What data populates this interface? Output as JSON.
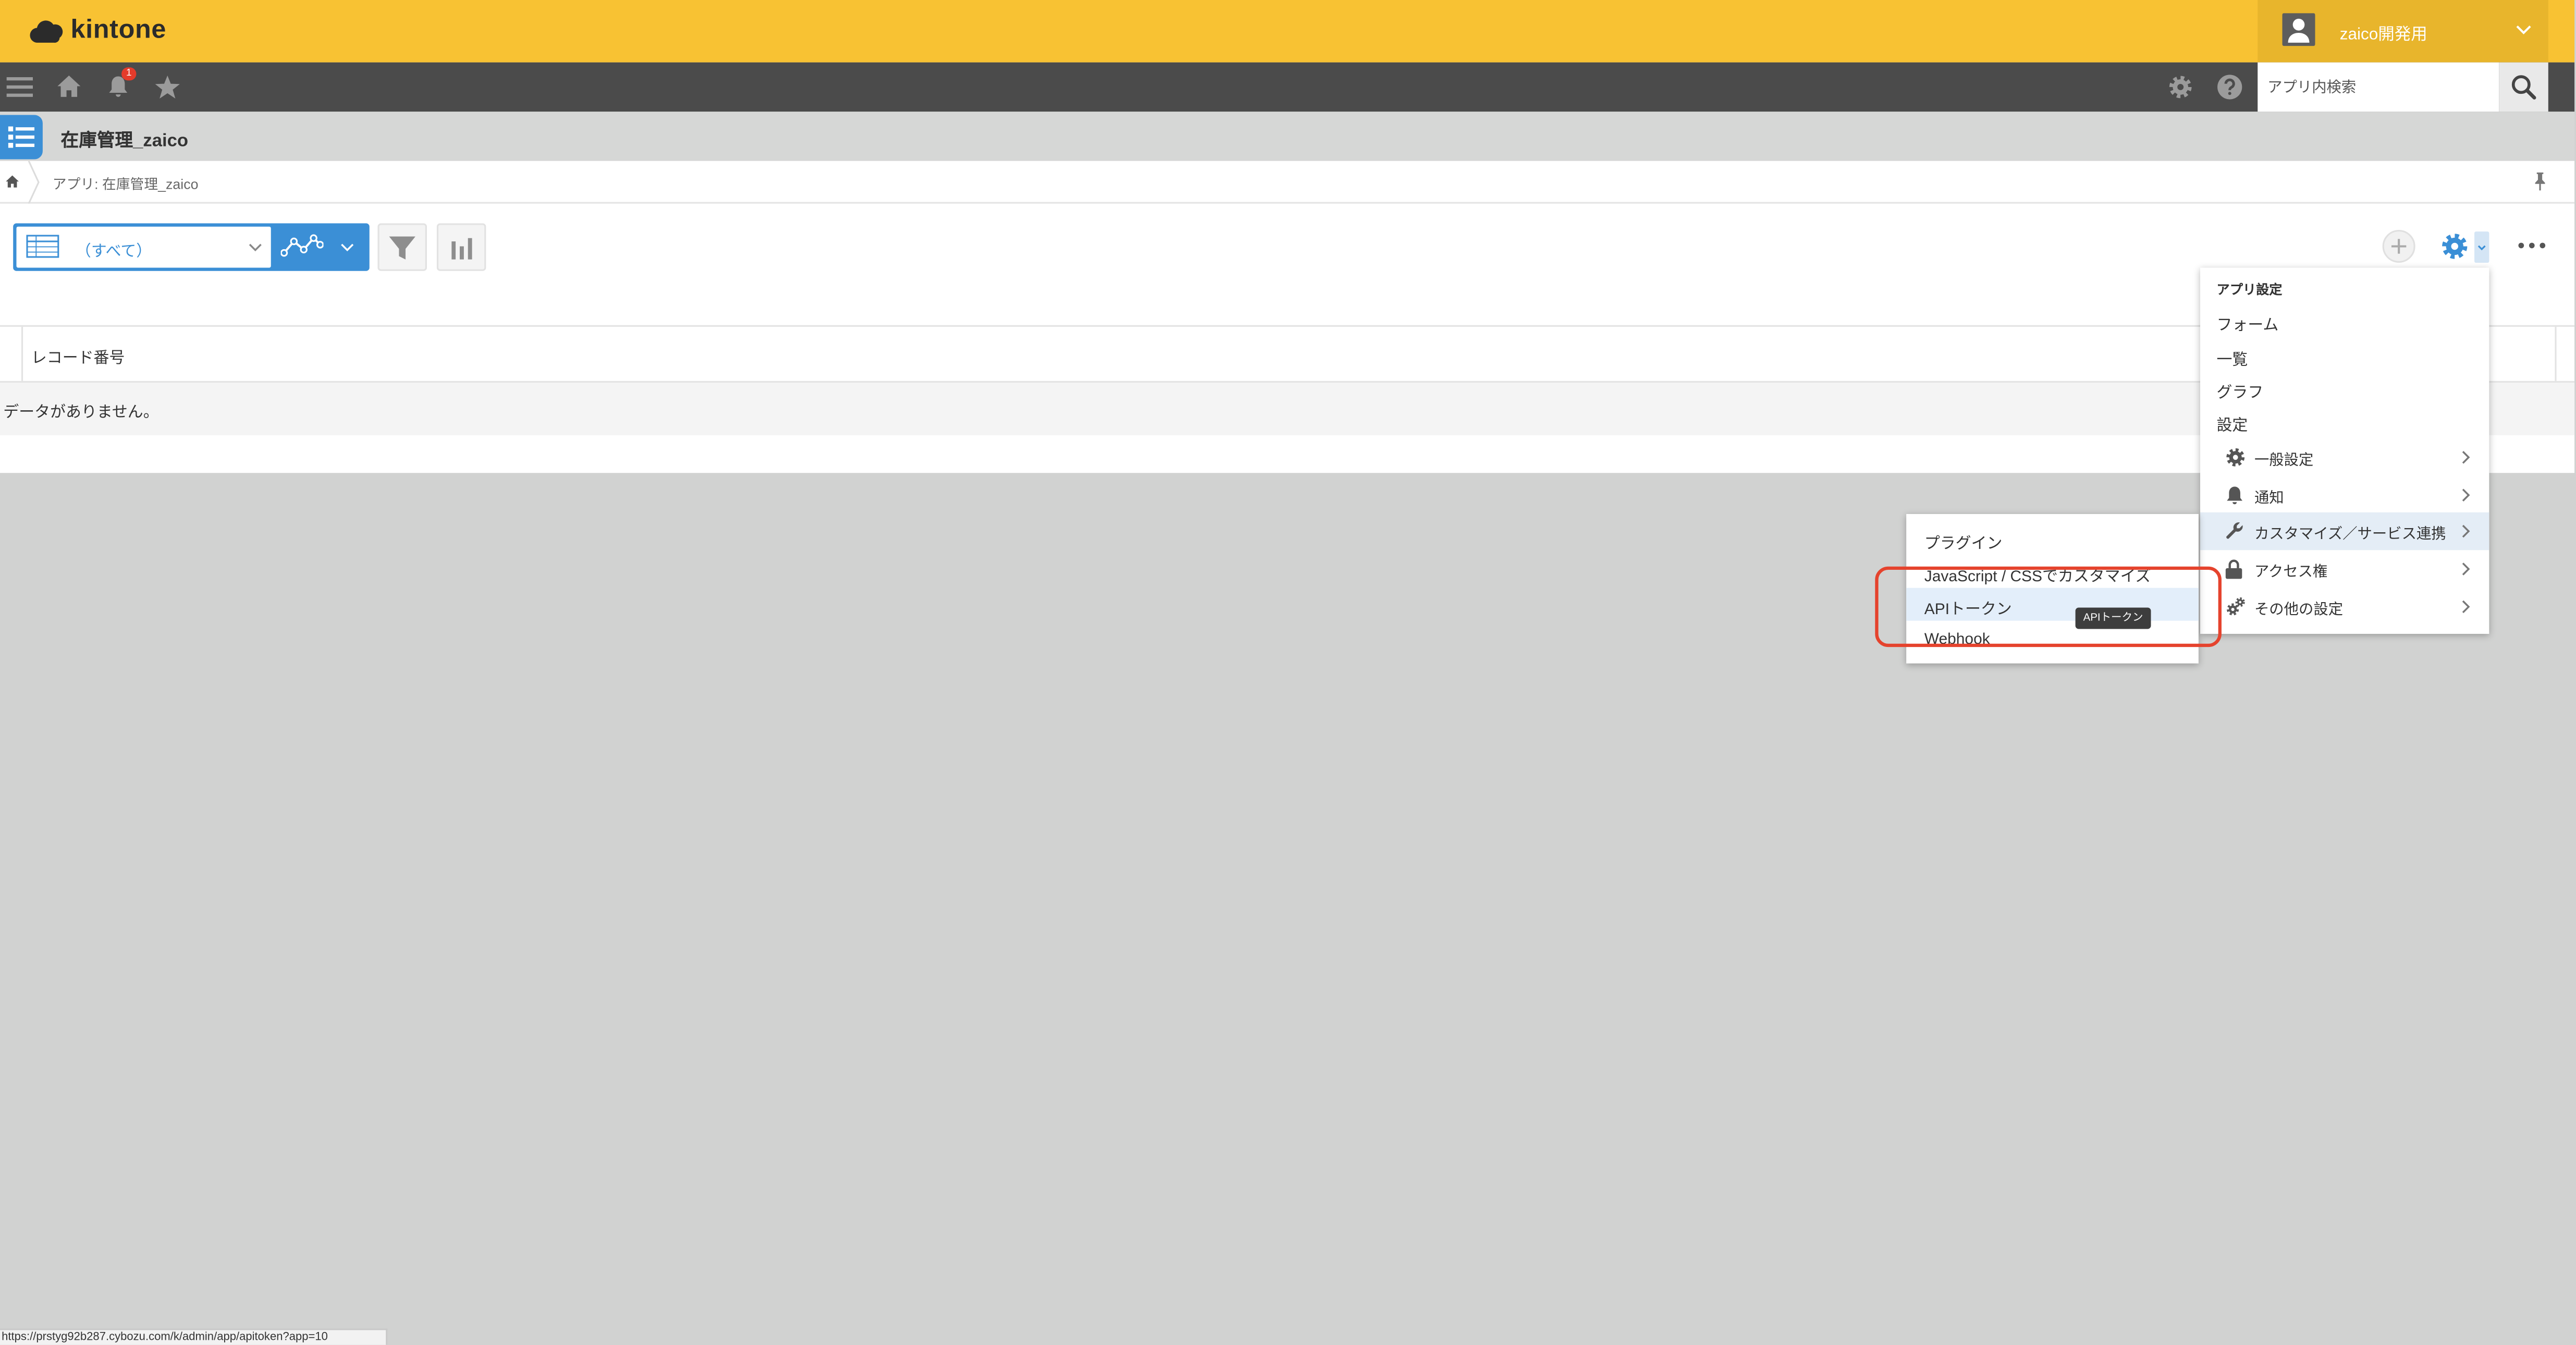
{
  "header": {
    "logo_text": "kintone",
    "user_name": "zaico開発用"
  },
  "nav": {
    "notification_count": "1",
    "search_placeholder": "アプリ内検索",
    "icons": [
      "menu-icon",
      "home-icon",
      "bell-icon",
      "star-icon",
      "gear-icon",
      "help-icon",
      "search-icon"
    ]
  },
  "app": {
    "title": "在庫管理_zaico"
  },
  "breadcrumb": {
    "app_label": "アプリ: 在庫管理_zaico"
  },
  "toolbar": {
    "view_selected": "（すべて）"
  },
  "table": {
    "columns": [
      "レコード番号"
    ],
    "empty_message": "データがありません。"
  },
  "settings_menu": {
    "heading": "アプリ設定",
    "items": [
      "フォーム",
      "一覧",
      "グラフ"
    ],
    "section_label": "設定",
    "sub_items": [
      {
        "label": "一般設定",
        "icon": "gear-icon"
      },
      {
        "label": "通知",
        "icon": "bell-icon"
      },
      {
        "label": "カスタマイズ／サービス連携",
        "icon": "wrench-icon",
        "highlighted": true
      },
      {
        "label": "アクセス権",
        "icon": "lock-icon"
      },
      {
        "label": "その他の設定",
        "icon": "gears-icon"
      }
    ]
  },
  "submenu": {
    "items": [
      "プラグイン",
      "JavaScript / CSSでカスタマイズ",
      "APIトークン",
      "Webhook"
    ],
    "highlighted": "APIトークン"
  },
  "tooltip": {
    "text": "APIトークン"
  },
  "status_bar": {
    "url": "https://prstyg92b287.cybozu.com/k/admin/app/apitoken?app=10"
  },
  "colors": {
    "header_yellow": "#f8c233",
    "header_yellow_dark": "#e8b52c",
    "nav_dark": "#4b4b4b",
    "accent_blue": "#3b8fd6",
    "annotation_red": "#e5432d"
  }
}
